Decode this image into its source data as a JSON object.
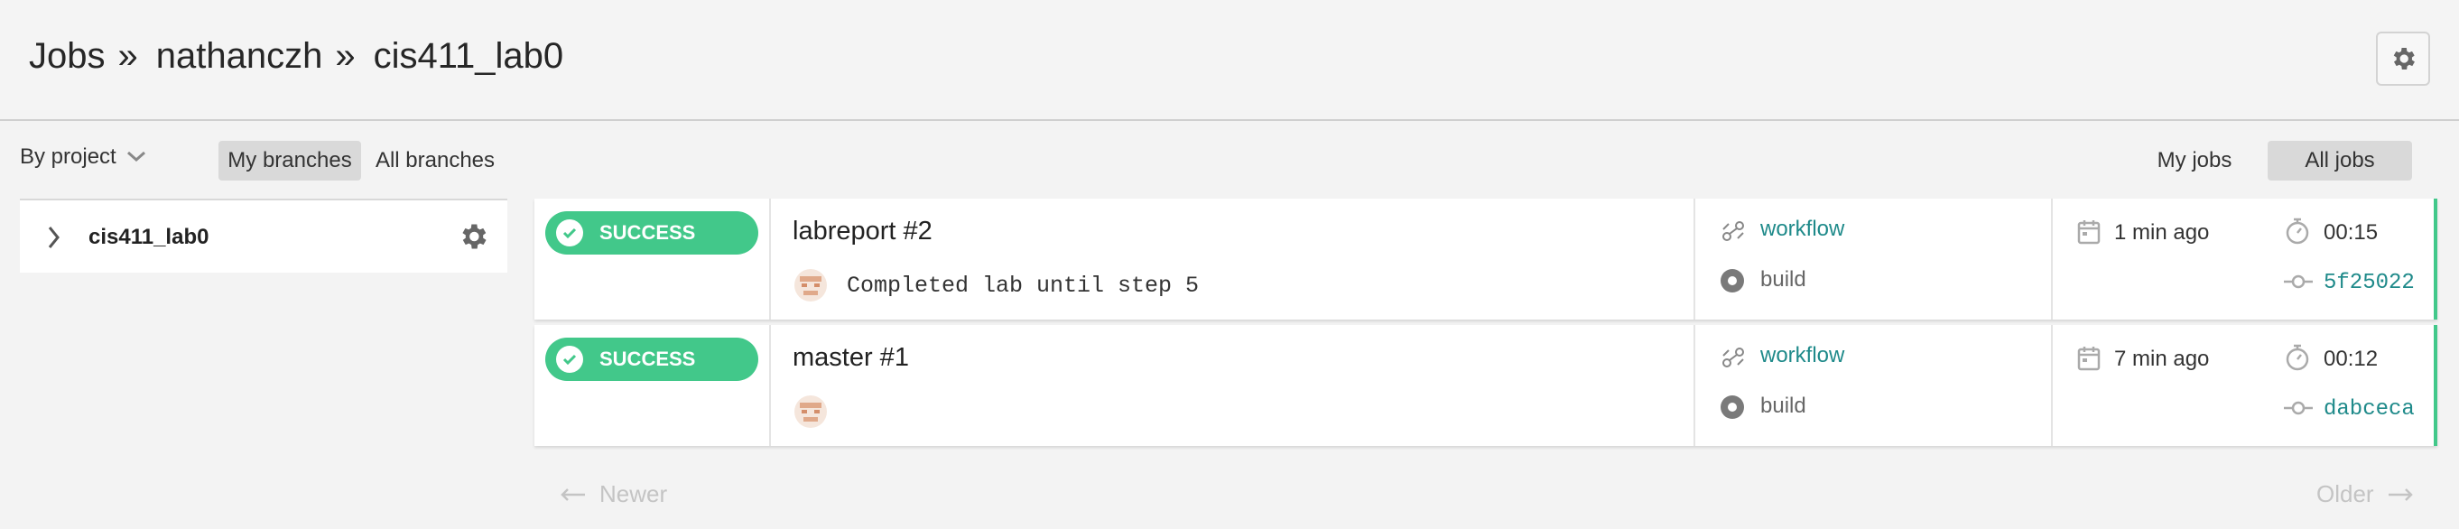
{
  "header": {
    "crumbs": [
      "Jobs",
      "nathanczh",
      "cis411_lab0"
    ],
    "separator": "»",
    "settings_icon": "gear-icon"
  },
  "filters": {
    "group_by": "By project",
    "branch_tabs": [
      "My branches",
      "All branches"
    ],
    "active_branch_tab": "My branches",
    "job_tabs": [
      "My jobs",
      "All jobs"
    ],
    "active_job_tab": "All jobs"
  },
  "sidebar": {
    "projects": [
      {
        "name": "cis411_lab0"
      }
    ]
  },
  "jobs": [
    {
      "status": "SUCCESS",
      "title": "labreport #2",
      "commit_message": "Completed lab until step 5",
      "workflow": "workflow",
      "job_name": "build",
      "time_ago": "1 min ago",
      "duration": "00:15",
      "sha": "5f25022"
    },
    {
      "status": "SUCCESS",
      "title": "master #1",
      "commit_message": "",
      "workflow": "workflow",
      "job_name": "build",
      "time_ago": "7 min ago",
      "duration": "00:12",
      "sha": "dabceca"
    }
  ],
  "pagination": {
    "newer": "Newer",
    "older": "Older"
  },
  "colors": {
    "success": "#42c88a",
    "link": "#1f8a8a",
    "background": "#f3f3f3"
  }
}
